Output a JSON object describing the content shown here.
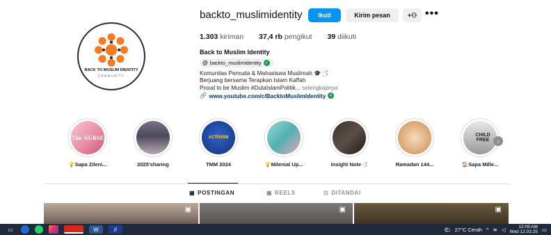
{
  "profile": {
    "username": "backto_muslimidentity",
    "follow_label": "Ikuti",
    "message_label": "Kirim pesan",
    "suggest_label": "+⚇",
    "more_label": "•••",
    "avatar_text_top": "BACK TO MUSLIM IDENTITY",
    "avatar_text_bottom": "COMMUNITY",
    "stats": {
      "posts_value": "1.303",
      "posts_label": "kiriman",
      "followers_value": "37,4 rb",
      "followers_label": "pengikut",
      "following_value": "39",
      "following_label": "diikuti"
    },
    "full_name": "Back to Muslim Identity",
    "threads_handle": "backto_muslimidentity",
    "bio_lines": [
      "Komunitas Pemuda & Mahasiswa Muslimah 🎓📑",
      "Berjuang bersama Terapkan Islam Kaffah",
      "Proud to be Muslim #DutaIslamPolitik..."
    ],
    "bio_more": "selengkapnya",
    "link": "www.youtube.com/c/BacktoMuslimIdentity"
  },
  "highlights": [
    {
      "label": "💡Sapa Zileni...",
      "inner_text": "The NURSE"
    },
    {
      "label": "2025'sharing",
      "inner_text": ""
    },
    {
      "label": "TMM 2024",
      "inner_text": "ACTIVISM"
    },
    {
      "label": "💡Milenial Up...",
      "inner_text": ""
    },
    {
      "label": "Insight Note📑",
      "inner_text": ""
    },
    {
      "label": "Ramadan 144...",
      "inner_text": ""
    },
    {
      "label": "🏠Sapa Mille...",
      "inner_text": "CHILD FREE"
    }
  ],
  "tabs": [
    {
      "label": "POSTINGAN",
      "icon": "▦"
    },
    {
      "label": "REELS",
      "icon": "▣"
    },
    {
      "label": "DITANDAI",
      "icon": "⊡"
    }
  ],
  "taskbar": {
    "weather": "27°C  Cerah",
    "time": "12:09 AM",
    "date": "Wed 12.03.25"
  },
  "colors": {
    "accent": "#0095f6",
    "verified": "#1d9b52",
    "link": "#00376b",
    "taskbar": "#1f2a3a"
  }
}
